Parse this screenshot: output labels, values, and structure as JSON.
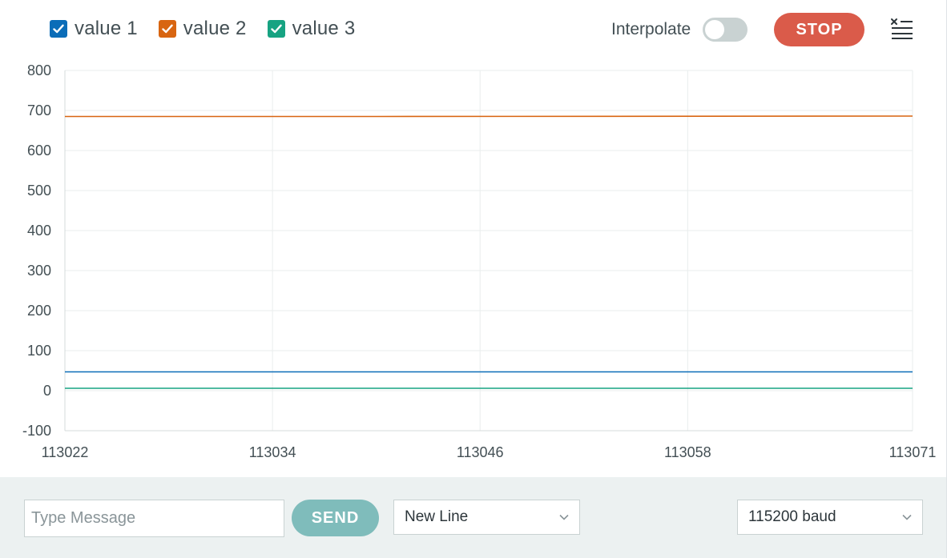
{
  "toolbar": {
    "interpolate_label": "Interpolate",
    "interpolate_on": false,
    "stop_label": "STOP",
    "clear_icon": "clear-list-icon"
  },
  "bottom": {
    "message_placeholder": "Type Message",
    "send_label": "SEND",
    "line_ending": "New Line",
    "baud_rate": "115200 baud"
  },
  "chart_data": {
    "type": "line",
    "xlim": [
      113022,
      113071
    ],
    "ylim": [
      -100,
      800
    ],
    "x_ticks": [
      "113022",
      "113034",
      "113046",
      "113058",
      "113071"
    ],
    "y_ticks": [
      "800",
      "700",
      "600",
      "500",
      "400",
      "300",
      "200",
      "100",
      "0",
      "-100"
    ],
    "grid": true,
    "series": [
      {
        "name": "value 1",
        "color": "#0b6db8",
        "checked": true,
        "x": [
          113022,
          113071
        ],
        "y": [
          47,
          47
        ]
      },
      {
        "name": "value 2",
        "color": "#d86511",
        "checked": true,
        "x": [
          113022,
          113040,
          113071
        ],
        "y": [
          685,
          685,
          686
        ]
      },
      {
        "name": "value 3",
        "color": "#17a382",
        "checked": true,
        "x": [
          113022,
          113071
        ],
        "y": [
          6,
          6
        ]
      }
    ]
  }
}
